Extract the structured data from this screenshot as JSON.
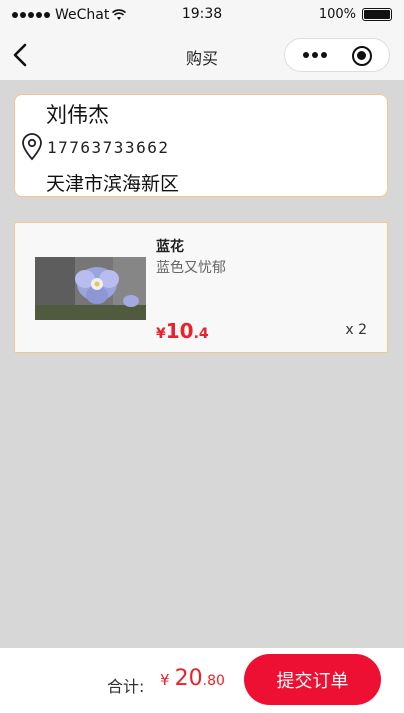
{
  "status_bar": {
    "carrier": "WeChat",
    "time": "19:38",
    "battery": "100%"
  },
  "nav": {
    "title": "购买"
  },
  "address": {
    "name": "刘伟杰",
    "phone": "17763733662",
    "detail": "天津市滨海新区"
  },
  "product": {
    "name": "蓝花",
    "description": "蓝色又忧郁",
    "price_symbol": "¥",
    "price_int": "10",
    "price_dec": ".4",
    "quantity": "x 2"
  },
  "footer": {
    "total_label": "合计:",
    "total_symbol": "¥",
    "total_int": "20",
    "total_dec": ".80",
    "submit_label": "提交订单"
  },
  "colors": {
    "accent": "#ee1032",
    "price": "#e8212a",
    "card_border": "#f0c98a"
  }
}
